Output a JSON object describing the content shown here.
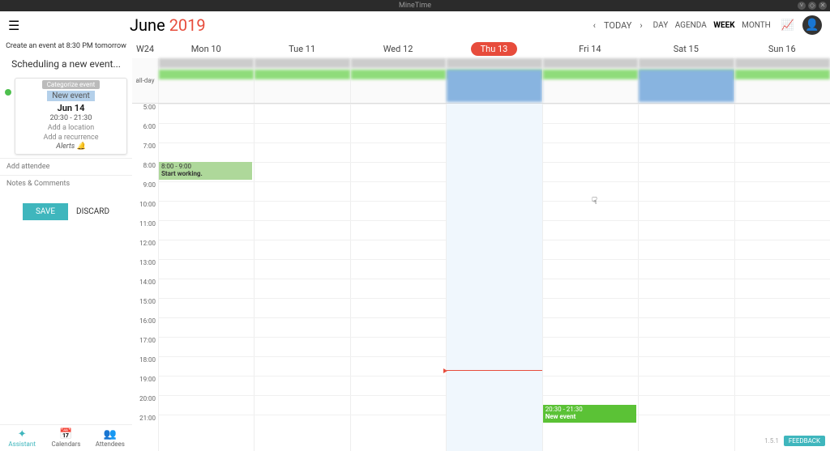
{
  "app": {
    "title": "MineTime"
  },
  "header": {
    "month": "June",
    "year": "2019",
    "today_label": "TODAY",
    "views": {
      "day": "DAY",
      "agenda": "AGENDA",
      "week": "WEEK",
      "month": "MONTH",
      "active": "WEEK"
    }
  },
  "sidebar": {
    "create_hint": "Create an event at 8:30 PM tomorrow",
    "scheduling_title": "Scheduling a new event...",
    "categorize": "Categorize event",
    "event": {
      "title": "New event",
      "date": "Jun 14",
      "time": "20:30 - 21:30",
      "add_location": "Add a location",
      "add_recurrence": "Add a recurrence",
      "alerts": "Alerts"
    },
    "add_attendee": "Add attendee",
    "notes": "Notes & Comments",
    "save": "SAVE",
    "discard": "DISCARD",
    "tabs": {
      "assistant": "Assistant",
      "calendars": "Calendars",
      "attendees": "Attendees"
    }
  },
  "calendar": {
    "week_label": "W24",
    "allday_label": "all-day",
    "days": [
      "Mon 10",
      "Tue 11",
      "Wed 12",
      "Thu 13",
      "Fri 14",
      "Sat 15",
      "Sun 16"
    ],
    "today_index": 3,
    "hours": [
      "5:00",
      "6:00",
      "7:00",
      "8:00",
      "9:00",
      "10:00",
      "11:00",
      "12:00",
      "13:00",
      "14:00",
      "15:00",
      "16:00",
      "17:00",
      "18:00",
      "19:00",
      "20:00",
      "21:00"
    ],
    "events": {
      "startworking": {
        "time": "8:00 - 9:00",
        "title": "Start working."
      },
      "newevent": {
        "time": "20:30 - 21:30",
        "title": "New event"
      }
    }
  },
  "footer": {
    "version": "1.5.1",
    "feedback": "FEEDBACK"
  }
}
